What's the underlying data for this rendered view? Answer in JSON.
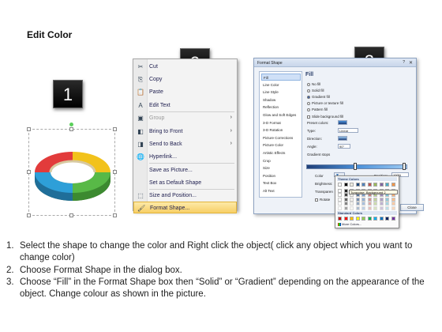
{
  "title": "Edit Color",
  "step_badges": [
    "1",
    "2",
    "3"
  ],
  "context_menu": {
    "items": [
      {
        "icon": "cut-icon",
        "glyph": "✂",
        "label": "Cut",
        "disabled": false,
        "submenu": false
      },
      {
        "icon": "copy-icon",
        "glyph": "⎘",
        "label": "Copy",
        "disabled": false,
        "submenu": false
      },
      {
        "icon": "paste-icon",
        "glyph": "📋",
        "label": "Paste",
        "disabled": false,
        "submenu": false
      },
      {
        "icon": "edit-text-icon",
        "glyph": "A",
        "label": "Edit Text",
        "disabled": false,
        "submenu": false
      },
      {
        "icon": "group-icon",
        "glyph": "▣",
        "label": "Group",
        "disabled": true,
        "submenu": true
      },
      {
        "icon": "bring-to-front-icon",
        "glyph": "◧",
        "label": "Bring to Front",
        "disabled": false,
        "submenu": true
      },
      {
        "icon": "send-to-back-icon",
        "glyph": "◨",
        "label": "Send to Back",
        "disabled": false,
        "submenu": true
      },
      {
        "icon": "hyperlink-icon",
        "glyph": "🌐",
        "label": "Hyperlink...",
        "disabled": false,
        "submenu": false
      },
      {
        "icon": "none",
        "glyph": "",
        "label": "Save as Picture...",
        "disabled": false,
        "submenu": false
      },
      {
        "icon": "none",
        "glyph": "",
        "label": "Set as Default Shape",
        "disabled": false,
        "submenu": false
      },
      {
        "icon": "size-position-icon",
        "glyph": "⬚",
        "label": "Size and Position...",
        "disabled": false,
        "submenu": false
      },
      {
        "icon": "format-shape-icon",
        "glyph": "🖌",
        "label": "Format Shape...",
        "disabled": false,
        "submenu": false
      }
    ]
  },
  "dialog": {
    "title": "Format Shape",
    "help": "?",
    "close_x": "✕",
    "nav": [
      "Fill",
      "Line Color",
      "Line Style",
      "Shadow",
      "Reflection",
      "Glow and Soft Edges",
      "3-D Format",
      "3-D Rotation",
      "Picture Corrections",
      "Picture Color",
      "Artistic Effects",
      "Crop",
      "Size",
      "Position",
      "Text Box",
      "Alt Text"
    ],
    "section": "Fill",
    "fill_options": [
      {
        "label": "No fill",
        "on": false
      },
      {
        "label": "Solid fill",
        "on": false
      },
      {
        "label": "Gradient fill",
        "on": true
      },
      {
        "label": "Picture or texture fill",
        "on": false
      },
      {
        "label": "Pattern fill",
        "on": false
      }
    ],
    "slide_bg": "Slide background fill",
    "preset_label": "Preset colors:",
    "type_label": "Type:",
    "type_value": "Linear",
    "direction_label": "Direction:",
    "angle_label": "Angle:",
    "angle_value": "90°",
    "gradient_stops": "Gradient stops",
    "color_label": "Color",
    "position_label": "Position:",
    "position_value": "100%",
    "brightness_label": "Brightness:",
    "transparency_label": "Transparen",
    "rotate_label": "Rotate",
    "close_button": "Close"
  },
  "color_popup": {
    "theme_header": "Theme Colors",
    "tooltip": "Turquoise, Background 2",
    "standard_header": "Standard Colors",
    "more": "More Colors...",
    "theme_row": [
      "#ffffff",
      "#000000",
      "#eeece1",
      "#1f497d",
      "#4f81bd",
      "#c0504d",
      "#9bbb59",
      "#8064a2",
      "#4bacc6",
      "#f79646"
    ],
    "standard_row": [
      "#c00000",
      "#ff0000",
      "#ffc000",
      "#ffff00",
      "#92d050",
      "#00b050",
      "#00b0f0",
      "#0070c0",
      "#002060",
      "#7030a0"
    ]
  },
  "ring_colors": [
    "#e23b3b",
    "#2e9fd8",
    "#f2c21b",
    "#58b947"
  ],
  "instructions": [
    {
      "num": "1.",
      "text": "Select the shape to change the color and Right click the object( click any object which you want to change color)"
    },
    {
      "num": "2.",
      "text": "Choose Format Shape in the dialog box."
    },
    {
      "num": "3.",
      "text": "Choose “Fill” in the Format Shape box then “Solid” or “Gradient” depending on the appearance of the object. Change colour as shown in the picture."
    }
  ]
}
